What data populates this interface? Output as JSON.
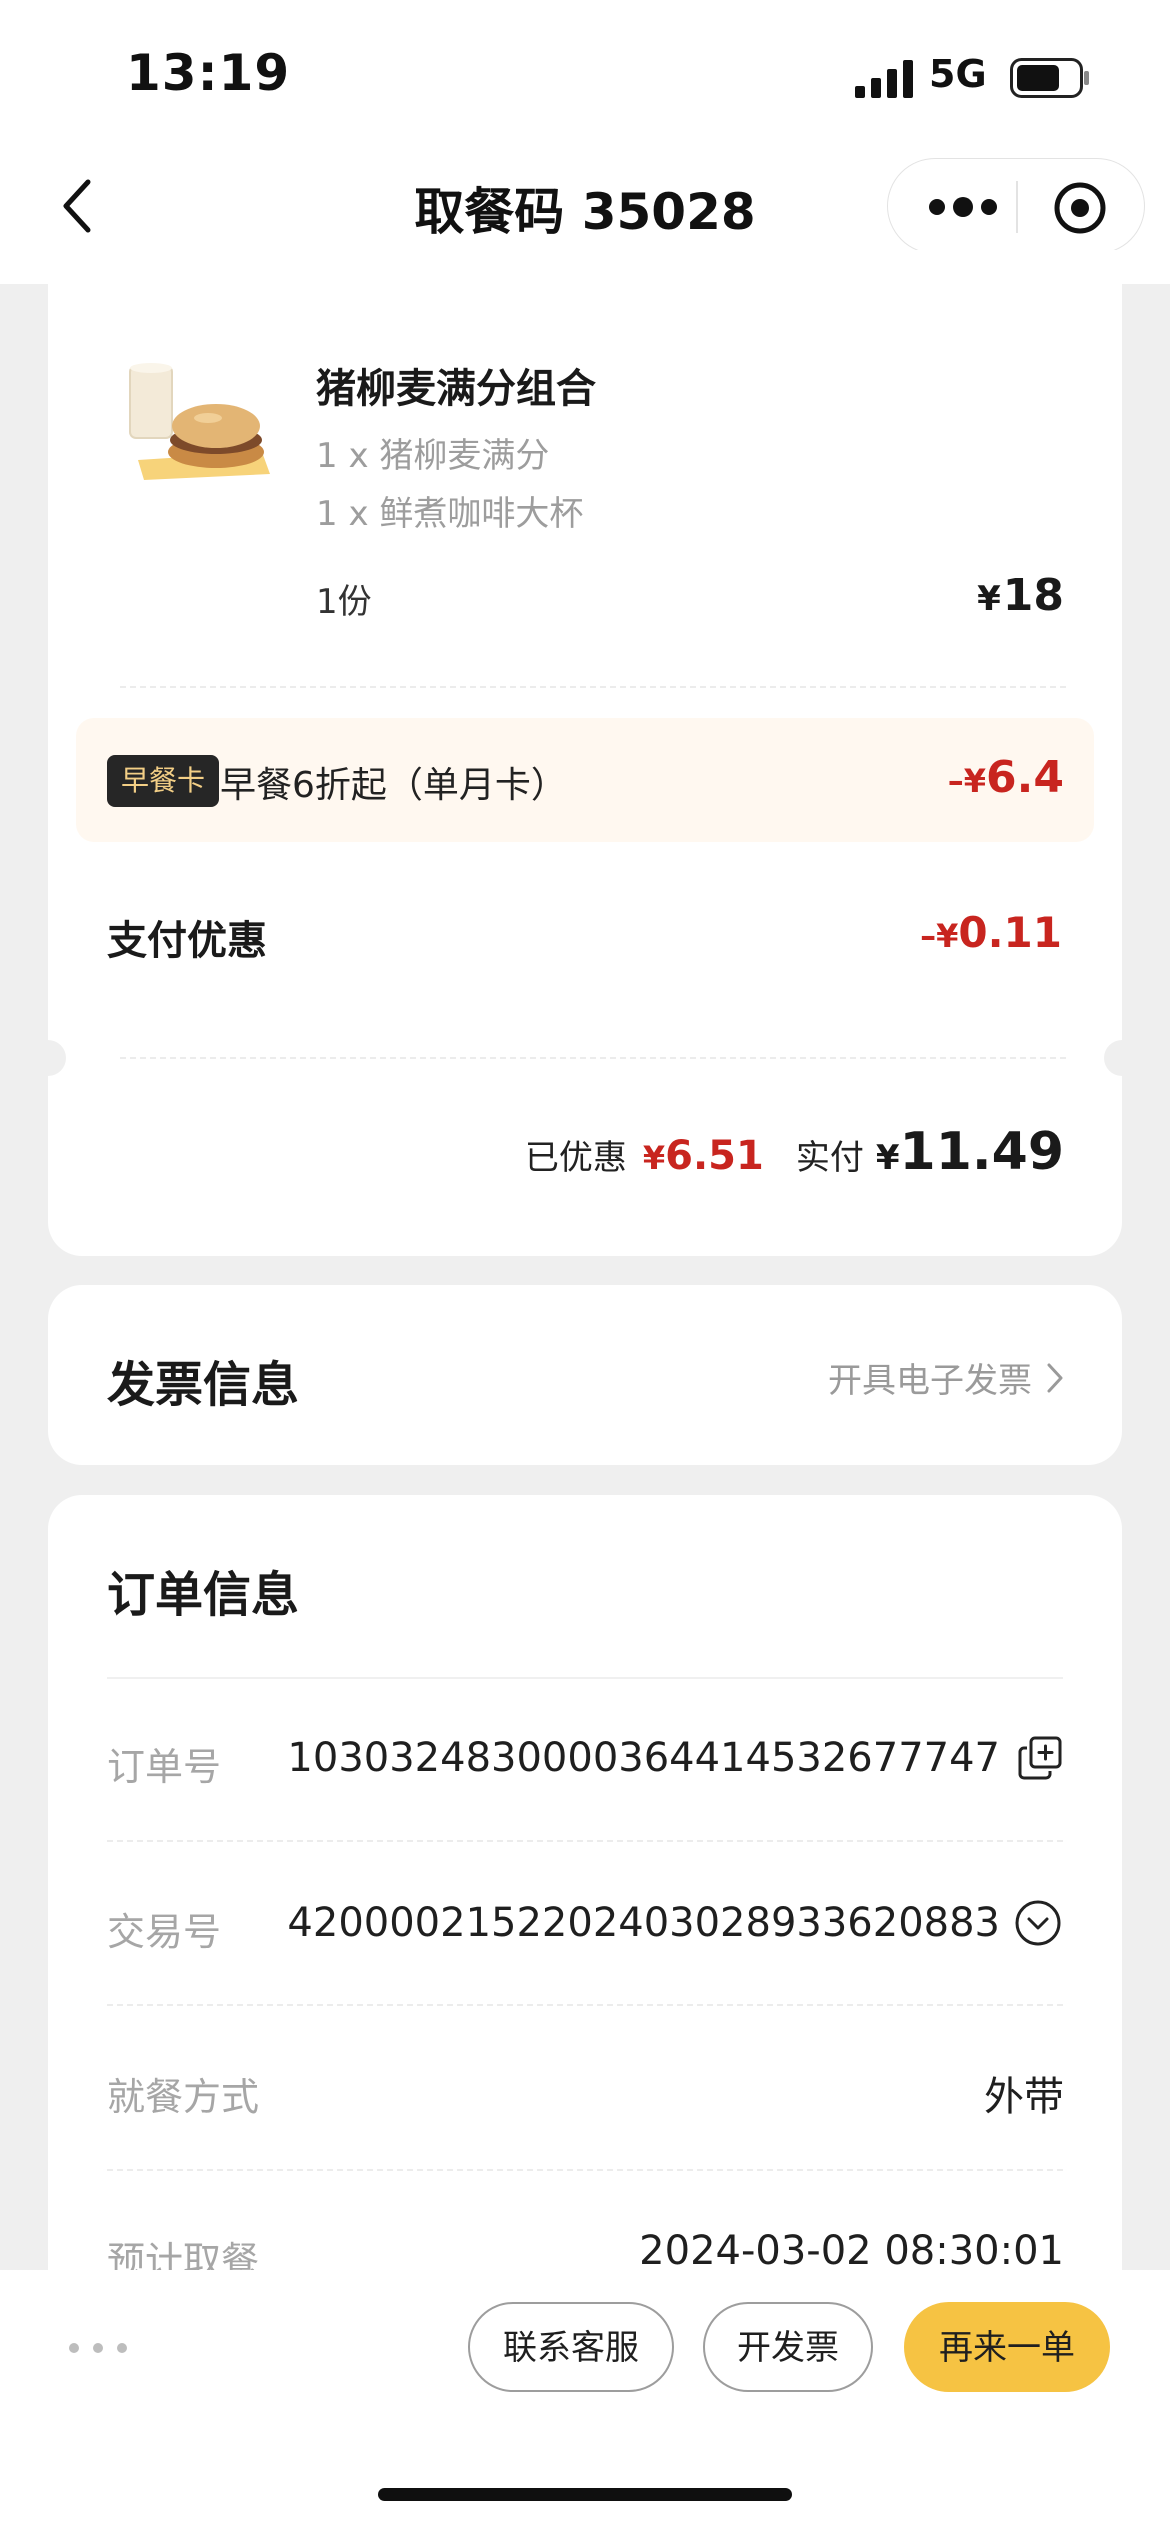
{
  "status_bar": {
    "time": "13:19",
    "network": "5G"
  },
  "nav": {
    "title": "取餐码 35028"
  },
  "product": {
    "name": "猪柳麦满分组合",
    "items": [
      "1 x 猪柳麦满分",
      "1 x 鲜煮咖啡大杯"
    ],
    "quantity": "1份",
    "currency": "¥",
    "price": "18"
  },
  "promo": {
    "tag": "早餐卡",
    "text": "早餐6折起（单月卡）",
    "sign": "–¥",
    "amount": "6.4"
  },
  "payment_discount": {
    "label": "支付优惠",
    "sign": "–¥",
    "amount": "0.11"
  },
  "summary": {
    "saved_label": "已优惠",
    "saved_currency": "¥",
    "saved_amount": "6.51",
    "paid_label": "实付",
    "paid_currency": "¥",
    "paid_amount": "11.49"
  },
  "invoice": {
    "title": "发票信息",
    "link": "开具电子发票"
  },
  "order": {
    "title": "订单信息",
    "rows": [
      {
        "label": "订单号",
        "value": "1030324830000364414532677747"
      },
      {
        "label": "交易号",
        "value": "4200002152202403028933620883"
      },
      {
        "label": "就餐方式",
        "value": "外带"
      },
      {
        "label": "预计取餐",
        "value": "2024-03-02 08:30:01"
      }
    ]
  },
  "bottom_bar": {
    "contact": "联系客服",
    "invoice": "开发票",
    "reorder": "再来一单"
  },
  "colors": {
    "accent_red": "#c8251f",
    "button_yellow": "#f6c343",
    "promo_bg": "#fff8f0",
    "tag_bg": "#262626",
    "tag_text": "#f3cf86"
  }
}
